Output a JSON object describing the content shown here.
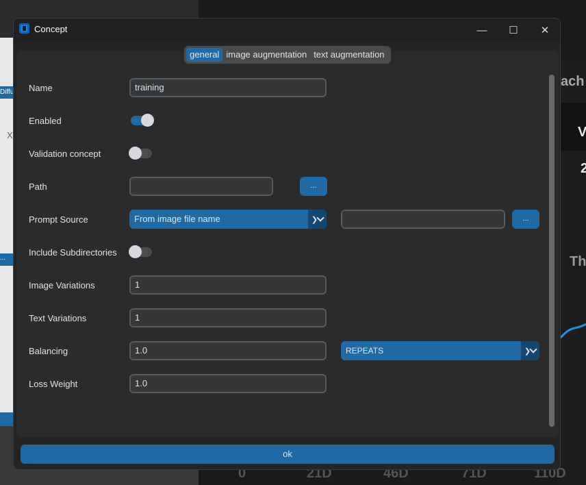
{
  "window": {
    "title": "Concept",
    "minimize": "—",
    "maximize": "☐",
    "close": "✕"
  },
  "tabs": [
    {
      "label": "general",
      "selected": true
    },
    {
      "label": "image augmentation"
    },
    {
      "label": "text augmentation"
    }
  ],
  "fields": {
    "name": {
      "label": "Name",
      "value": "training"
    },
    "enabled": {
      "label": "Enabled",
      "on": true
    },
    "validation": {
      "label": "Validation concept",
      "on": false
    },
    "path": {
      "label": "Path",
      "value": "",
      "button": "..."
    },
    "prompt_source": {
      "label": "Prompt Source",
      "selected": "From image file name",
      "extra_value": "",
      "button": "..."
    },
    "include_subdirs": {
      "label": "Include Subdirectories",
      "on": false
    },
    "image_variations": {
      "label": "Image Variations",
      "value": "1"
    },
    "text_variations": {
      "label": "Text Variations",
      "value": "1"
    },
    "balancing": {
      "label": "Balancing",
      "value": "1.0",
      "strategy": "REPEATS"
    },
    "loss_weight": {
      "label": "Loss Weight",
      "value": "1.0"
    }
  },
  "ok_label": "ok",
  "background": {
    "texts": [
      "ach",
      "V",
      "2",
      "Th"
    ],
    "axis_ticks": [
      "0",
      "21D",
      "46D",
      "71D",
      "110D"
    ],
    "left_texts": [
      "Diffu",
      "X",
      "..."
    ]
  },
  "colors": {
    "accent": "#1f6aa5",
    "bg": "#2b2b2b",
    "entry": "#343638"
  }
}
